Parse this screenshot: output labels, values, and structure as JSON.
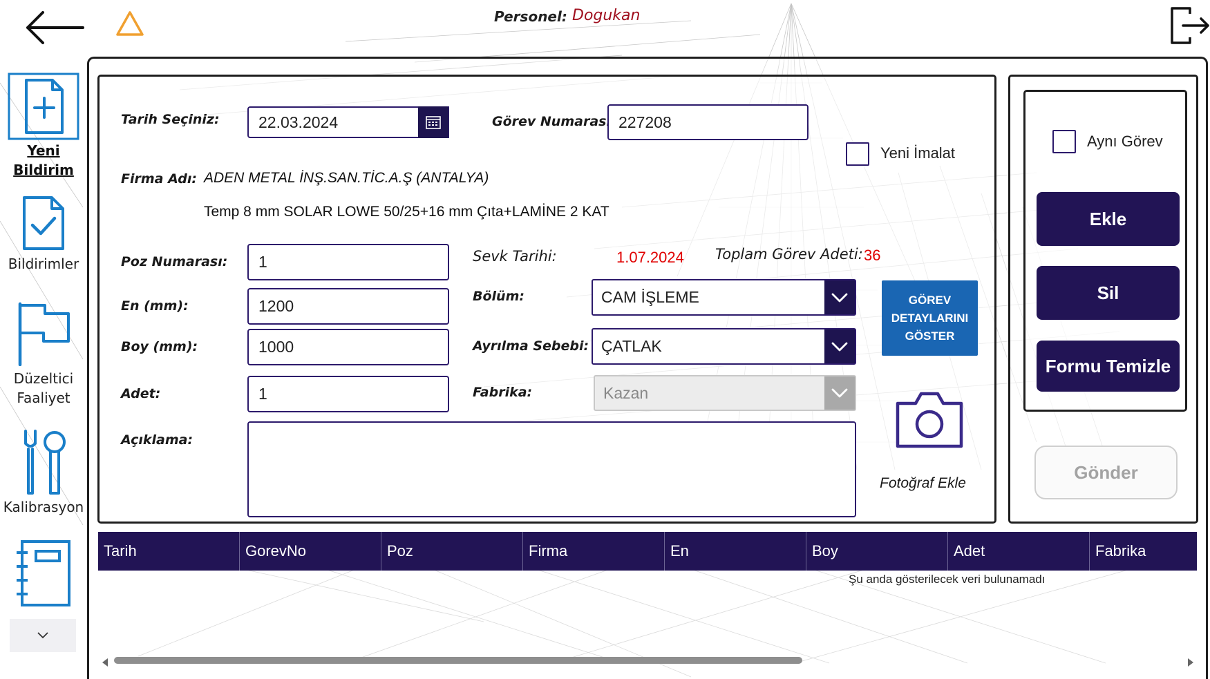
{
  "header": {
    "personel_label": "Personel:",
    "personel_name": "Dogukan"
  },
  "nav": {
    "items": [
      {
        "label": "Yeni Bildirim",
        "icon": "new-document-icon",
        "active": true
      },
      {
        "label": "Bildirimler",
        "icon": "checked-document-icon",
        "active": false
      },
      {
        "label": "Düzeltici",
        "label2": "Faaliyet",
        "icon": "flag-icon",
        "active": false
      },
      {
        "label": "Kalibrasyon",
        "icon": "tools-icon",
        "active": false
      },
      {
        "label": "",
        "icon": "notebook-icon",
        "active": false
      }
    ]
  },
  "form": {
    "tarih_label": "Tarih Seçiniz:",
    "tarih_value": "22.03.2024",
    "gorev_no_label": "Görev Numarası:",
    "gorev_no_value": "227208",
    "yeni_imalat_label": "Yeni İmalat",
    "firma_label": "Firma Adı:",
    "firma_value": "ADEN METAL İNŞ.SAN.TİC.A.Ş (ANTALYA)",
    "product_desc": "Temp 8 mm SOLAR LOWE 50/25+16 mm Çıta+LAMİNE 2 KAT",
    "poz_label": "Poz Numarası:",
    "poz_value": "1",
    "en_label": "En (mm):",
    "en_value": "1200",
    "boy_label": "Boy (mm):",
    "boy_value": "1000",
    "adet_label": "Adet:",
    "adet_value": "1",
    "aciklama_label": "Açıklama:",
    "aciklama_value": "",
    "sevk_label": "Sevk Tarihi:",
    "sevk_value": "1.07.2024",
    "toplam_label": "Toplam Görev Adeti:",
    "toplam_value": "36",
    "bolum_label": "Bölüm:",
    "bolum_value": "CAM İŞLEME",
    "ayrilma_label": "Ayrılma Sebebi:",
    "ayrilma_value": "ÇATLAK",
    "fabrika_label": "Fabrika:",
    "fabrika_value": "Kazan",
    "detay_button": "GÖREV DETAYLARINI GÖSTER",
    "foto_label": "Fotoğraf Ekle"
  },
  "side": {
    "ayni_gorev_label": "Aynı Görev",
    "ekle": "Ekle",
    "sil": "Sil",
    "temizle": "Formu Temizle",
    "gonder": "Gönder"
  },
  "table": {
    "columns": [
      "Tarih",
      "GorevNo",
      "Poz",
      "Firma",
      "En",
      "Boy",
      "Adet",
      "Fabrika"
    ],
    "rows": [],
    "empty_message": "Şu anda gösterilecek veri bulunamadı"
  },
  "colors": {
    "primary": "#221455",
    "accent_red": "#e00000",
    "detail_button": "#1a66b3",
    "nav_icon": "#1a7fc9",
    "warning": "#f0a030"
  }
}
